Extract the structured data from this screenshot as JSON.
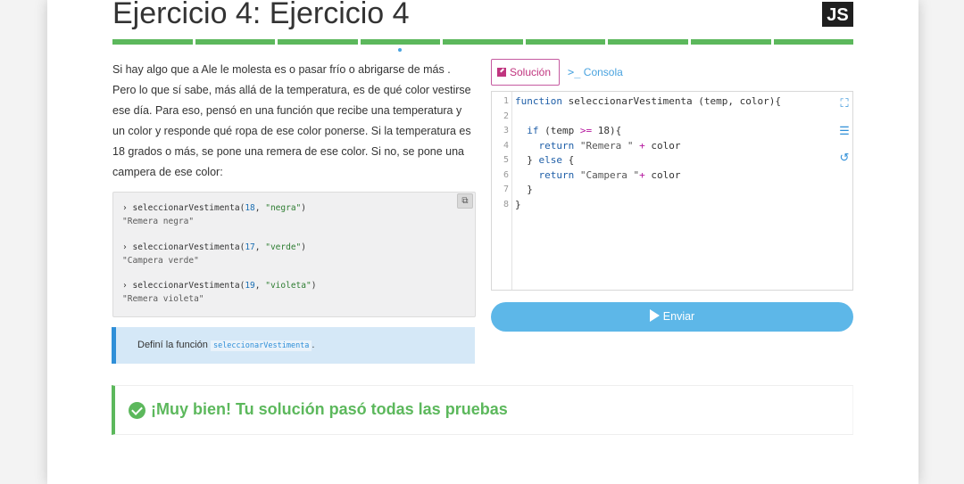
{
  "header": {
    "title": "Ejercicio 4: Ejercicio 4",
    "language_badge": "JS",
    "progress_segments": 9,
    "progress_color": "#5cb85c"
  },
  "description": {
    "text": "Si hay algo que a Ale le molesta es o pasar frío o abrigarse de más . Pero lo que sí sabe, más allá de la temperatura, es de qué color vestirse ese día. Para eso, pensó en una función que recibe una temperatura y un color y responde qué ropa de ese color ponerse. Si la temperatura es 18 grados o más, se pone una remera de ese color. Si no, se pone una campera de ese color:"
  },
  "examples": [
    {
      "prompt": "›",
      "fn": "seleccionarVestimenta",
      "num": "18",
      "str": "\"negra\"",
      "result": "\"Remera negra\""
    },
    {
      "prompt": "›",
      "fn": "seleccionarVestimenta",
      "num": "17",
      "str": "\"verde\"",
      "result": "\"Campera verde\""
    },
    {
      "prompt": "›",
      "fn": "seleccionarVestimenta",
      "num": "19",
      "str": "\"violeta\"",
      "result": "\"Remera violeta\""
    }
  ],
  "hint": {
    "prefix": "Definí la función",
    "code": "seleccionarVestimenta",
    "suffix": "."
  },
  "tabs": {
    "solution": "Solución",
    "console": "Consola"
  },
  "editor": {
    "line_numbers": [
      "1",
      "2",
      "3",
      "4",
      "5",
      "6",
      "7",
      "8"
    ]
  },
  "submit_label": "Enviar",
  "result_message": "¡Muy bien! Tu solución pasó todas las pruebas",
  "colors": {
    "accent_blue": "#5db7e8",
    "success_green": "#5cb85c",
    "solution_tab": "#c0357f"
  }
}
